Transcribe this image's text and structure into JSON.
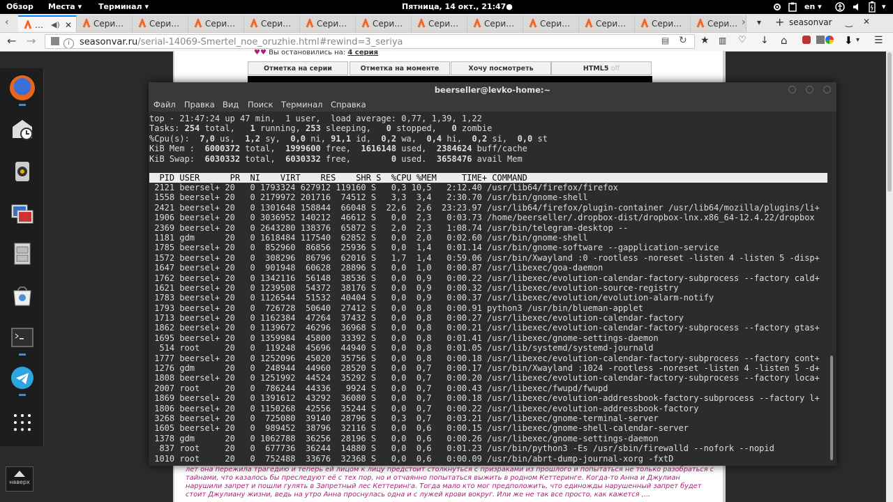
{
  "topbar": {
    "overview": "Обзор",
    "places": "Места",
    "terminal": "Терминал",
    "clock": "Пятница, 14 окт., 21:47",
    "lang": "en"
  },
  "tabs": [
    {
      "label": "…"
    },
    {
      "label": "Сери…"
    },
    {
      "label": "Сери…"
    },
    {
      "label": "Сери…"
    },
    {
      "label": "Сери…"
    },
    {
      "label": "Сери…"
    },
    {
      "label": "Сери…"
    },
    {
      "label": "Сери…"
    },
    {
      "label": "Сери…"
    },
    {
      "label": "Сери…"
    },
    {
      "label": "Сери…"
    },
    {
      "label": "Сери…"
    }
  ],
  "tabbar": {
    "search_label": "seasonvar",
    "new_tab": "+"
  },
  "url": {
    "domain": "seasonvar.ru",
    "path": "/serial-14069-Smertel_noe_oruzhie.html#rewind=3_seriya"
  },
  "page": {
    "partial_text": "Вы остановились на: ",
    "partial_link": "4 серия",
    "buttons": [
      "Отметка на серии",
      "Отметка на моменте",
      "Хочу посмотреть",
      "HTML5"
    ],
    "html5_off": "off",
    "description": "лет она пережила трагедию и теперь ей лицом к лицу предстоит столкнуться с призраками из прошлого и попытаться не только разобраться с тайнами, что казалось бы преследуют её с тех пор, но и отчаянно попытаться выжить в родном Кеттеринге. Когда-то Анна и Джулиан нарушили запрет и пошли гулять в Запретный лес Кеттеринга. Тогда мало кто мог предположить, что единожды нарушенный запрет будет стоит Джулиану жизни, ведь на утро Анна проснулась одна и с лужей крови вокруг. Или же не так все просто, как кажется ,..."
  },
  "dock": {
    "up_label": "наверх"
  },
  "terminal": {
    "title": "beerseller@levko-home:~",
    "menu": [
      "Файл",
      "Правка",
      "Вид",
      "Поиск",
      "Терминал",
      "Справка"
    ],
    "summary": {
      "line1": "top - 21:47:24 up 47 min,  1 user,  load average: 0,77, 1,39, 1,22",
      "tasks": {
        "total": "254",
        "running": "1",
        "sleeping": "253",
        "stopped": "0",
        "zombie": "0"
      },
      "cpu": {
        "us": "7,0",
        "sy": "1,2",
        "ni": "0,0",
        "id": "91,1",
        "wa": "0,2",
        "hi": "0,4",
        "si": "0,2",
        "st": "0,0"
      },
      "mem": {
        "total": "6000372",
        "free": "1999600",
        "used": "1616148",
        "buff": "2384624"
      },
      "swap": {
        "total": "6030332",
        "free": "6030332",
        "used": "0",
        "avail": "3658476"
      }
    },
    "header": "  PID USER      PR  NI    VIRT    RES    SHR S  %CPU %MEM     TIME+ COMMAND",
    "processes": [
      [
        "2121",
        "beersel+",
        "20",
        "0",
        "1793324",
        "627912",
        "119160",
        "S",
        "0,3",
        "10,5",
        "2:12.40",
        "/usr/lib64/firefox/firefox"
      ],
      [
        "1558",
        "beersel+",
        "20",
        "0",
        "2179972",
        "201716",
        "74512",
        "S",
        "3,3",
        "3,4",
        "2:30.70",
        "/usr/bin/gnome-shell"
      ],
      [
        "2421",
        "beersel+",
        "20",
        "0",
        "1301648",
        "158844",
        "66048",
        "S",
        "22,6",
        "2,6",
        "23:23.97",
        "/usr/lib64/firefox/plugin-container /usr/lib64/mozilla/plugins/li+"
      ],
      [
        "1906",
        "beersel+",
        "20",
        "0",
        "3036952",
        "140212",
        "46612",
        "S",
        "0,0",
        "2,3",
        "0:03.73",
        "/home/beerseller/.dropbox-dist/dropbox-lnx.x86_64-12.4.22/dropbox"
      ],
      [
        "2369",
        "beersel+",
        "20",
        "0",
        "2643280",
        "138376",
        "65872",
        "S",
        "2,0",
        "2,3",
        "1:08.74",
        "/usr/bin/telegram-desktop --"
      ],
      [
        "1181",
        "gdm",
        "20",
        "0",
        "1618484",
        "117540",
        "62852",
        "S",
        "0,0",
        "2,0",
        "0:02.60",
        "/usr/bin/gnome-shell"
      ],
      [
        "1785",
        "beersel+",
        "20",
        "0",
        "852960",
        "86856",
        "25936",
        "S",
        "0,0",
        "1,4",
        "0:01.14",
        "/usr/bin/gnome-software --gapplication-service"
      ],
      [
        "1572",
        "beersel+",
        "20",
        "0",
        "308296",
        "86796",
        "62016",
        "S",
        "1,7",
        "1,4",
        "0:59.06",
        "/usr/bin/Xwayland :0 -rootless -noreset -listen 4 -listen 5 -disp+"
      ],
      [
        "1647",
        "beersel+",
        "20",
        "0",
        "901948",
        "60628",
        "28896",
        "S",
        "0,0",
        "1,0",
        "0:00.87",
        "/usr/libexec/goa-daemon"
      ],
      [
        "1762",
        "beersel+",
        "20",
        "0",
        "1342116",
        "56148",
        "38536",
        "S",
        "0,0",
        "0,9",
        "0:00.22",
        "/usr/libexec/evolution-calendar-factory-subprocess --factory cald+"
      ],
      [
        "1621",
        "beersel+",
        "20",
        "0",
        "1239508",
        "54372",
        "38176",
        "S",
        "0,0",
        "0,9",
        "0:00.32",
        "/usr/libexec/evolution-source-registry"
      ],
      [
        "1783",
        "beersel+",
        "20",
        "0",
        "1126544",
        "51532",
        "40404",
        "S",
        "0,0",
        "0,9",
        "0:00.37",
        "/usr/libexec/evolution/evolution-alarm-notify"
      ],
      [
        "1793",
        "beersel+",
        "20",
        "0",
        "726728",
        "50640",
        "27412",
        "S",
        "0,0",
        "0,8",
        "0:00.91",
        "python3 /usr/bin/blueman-applet"
      ],
      [
        "1713",
        "beersel+",
        "20",
        "0",
        "1162384",
        "47264",
        "37432",
        "S",
        "0,0",
        "0,8",
        "0:00.27",
        "/usr/libexec/evolution-calendar-factory"
      ],
      [
        "1862",
        "beersel+",
        "20",
        "0",
        "1139672",
        "46296",
        "36968",
        "S",
        "0,0",
        "0,8",
        "0:00.21",
        "/usr/libexec/evolution-calendar-factory-subprocess --factory gtas+"
      ],
      [
        "1695",
        "beersel+",
        "20",
        "0",
        "1359984",
        "45800",
        "33392",
        "S",
        "0,0",
        "0,8",
        "0:01.41",
        "/usr/libexec/gnome-settings-daemon"
      ],
      [
        "514",
        "root",
        "20",
        "0",
        "119248",
        "45696",
        "44940",
        "S",
        "0,0",
        "0,8",
        "0:01.05",
        "/usr/lib/systemd/systemd-journald"
      ],
      [
        "1777",
        "beersel+",
        "20",
        "0",
        "1252096",
        "45020",
        "35756",
        "S",
        "0,0",
        "0,8",
        "0:00.18",
        "/usr/libexec/evolution-calendar-factory-subprocess --factory cont+"
      ],
      [
        "1276",
        "gdm",
        "20",
        "0",
        "248944",
        "44960",
        "28520",
        "S",
        "0,0",
        "0,7",
        "0:00.17",
        "/usr/bin/Xwayland :1024 -rootless -noreset -listen 4 -listen 5 -d+"
      ],
      [
        "1808",
        "beersel+",
        "20",
        "0",
        "1251992",
        "44524",
        "35292",
        "S",
        "0,0",
        "0,7",
        "0:00.20",
        "/usr/libexec/evolution-calendar-factory-subprocess --factory loca+"
      ],
      [
        "2007",
        "root",
        "20",
        "0",
        "786244",
        "44336",
        "9924",
        "S",
        "0,0",
        "0,7",
        "0:00.43",
        "/usr/libexec/fwupd/fwupd"
      ],
      [
        "1869",
        "beersel+",
        "20",
        "0",
        "1391612",
        "43292",
        "36080",
        "S",
        "0,0",
        "0,7",
        "0:00.18",
        "/usr/libexec/evolution-addressbook-factory-subprocess --factory l+"
      ],
      [
        "1806",
        "beersel+",
        "20",
        "0",
        "1150268",
        "42556",
        "35244",
        "S",
        "0,0",
        "0,7",
        "0:00.22",
        "/usr/libexec/evolution-addressbook-factory"
      ],
      [
        "3268",
        "beersel+",
        "20",
        "0",
        "725080",
        "39140",
        "28796",
        "S",
        "0,3",
        "0,7",
        "0:03.21",
        "/usr/libexec/gnome-terminal-server"
      ],
      [
        "1605",
        "beersel+",
        "20",
        "0",
        "989452",
        "38796",
        "32116",
        "S",
        "0,0",
        "0,6",
        "0:00.15",
        "/usr/libexec/gnome-shell-calendar-server"
      ],
      [
        "1378",
        "gdm",
        "20",
        "0",
        "1062788",
        "36256",
        "28196",
        "S",
        "0,0",
        "0,6",
        "0:00.26",
        "/usr/libexec/gnome-settings-daemon"
      ],
      [
        "837",
        "root",
        "20",
        "0",
        "677736",
        "36244",
        "14880",
        "S",
        "0,0",
        "0,6",
        "0:01.23",
        "/usr/bin/python3 -Es /usr/sbin/firewalld --nofork --nopid"
      ],
      [
        "1010",
        "root",
        "20",
        "0",
        "752488",
        "33676",
        "32368",
        "S",
        "0,0",
        "0,6",
        "0:00.09",
        "/usr/bin/abrt-dump-journal-xorg -fxtD"
      ]
    ]
  },
  "colors": {
    "terminal_bg": "#2c2c2c",
    "accent_tab": "#0a84ff",
    "favicon": "#f26522",
    "description": "#b21c7a"
  }
}
